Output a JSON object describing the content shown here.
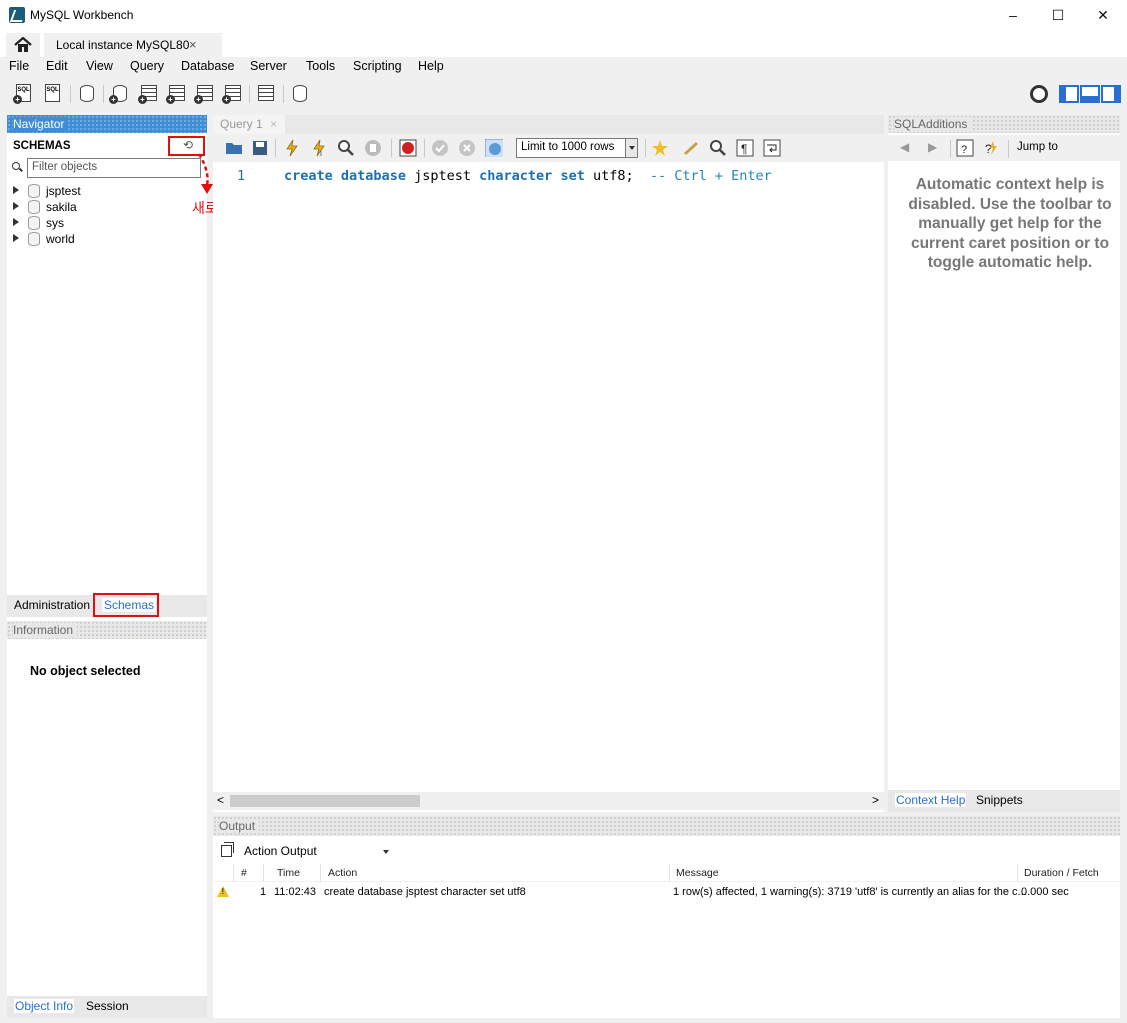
{
  "window": {
    "title": "MySQL Workbench",
    "minimize": "–",
    "maximize": "☐",
    "close": "✕"
  },
  "tabs": {
    "connection_tab": "Local instance MySQL80",
    "close_glyph": "×"
  },
  "menu": [
    "File",
    "Edit",
    "View",
    "Query",
    "Database",
    "Server",
    "Tools",
    "Scripting",
    "Help"
  ],
  "toolbar": {
    "sql_label": "SQL"
  },
  "navigator": {
    "header": "Navigator",
    "schemas_title": "SCHEMAS",
    "refresh_glyph": "⟲",
    "filter_placeholder": "Filter objects",
    "schemas": [
      "jsptest",
      "sakila",
      "sys",
      "world"
    ],
    "annotation": "새로고침",
    "tabs": [
      "Administration",
      "Schemas"
    ],
    "info_header": "Information",
    "no_object": "No object selected",
    "bottom_tabs": [
      "Object Info",
      "Session"
    ]
  },
  "query": {
    "tab_label": "Query 1",
    "limit_select": "Limit to 1000 rows",
    "line_number": "1",
    "code": {
      "kw1": "create",
      "kw2": "database",
      "name": "jsptest",
      "kw3": "character",
      "kw4": "set",
      "value": "utf8;",
      "comment": "-- Ctrl + Enter"
    }
  },
  "sql_additions": {
    "header": "SQLAdditions",
    "jump_to": "Jump to",
    "help_lines": [
      "Automatic context help is",
      "disabled. Use the toolbar to",
      "manually get help for the",
      "current caret position or to",
      "toggle automatic help."
    ],
    "tabs": [
      "Context Help",
      "Snippets"
    ]
  },
  "output": {
    "header": "Output",
    "select": "Action Output",
    "columns": [
      "#",
      "Time",
      "Action",
      "Message",
      "Duration / Fetch"
    ],
    "rows": [
      {
        "num": "1",
        "time": "11:02:43",
        "action": "create database jsptest character set utf8",
        "message": "1 row(s) affected, 1 warning(s): 3719 'utf8' is currently an alias for the c...",
        "duration": "0.000 sec"
      }
    ]
  },
  "colors": {
    "accent": "#3e8dd6",
    "keyword": "#1e6fb0",
    "annotation": "#e01010"
  }
}
